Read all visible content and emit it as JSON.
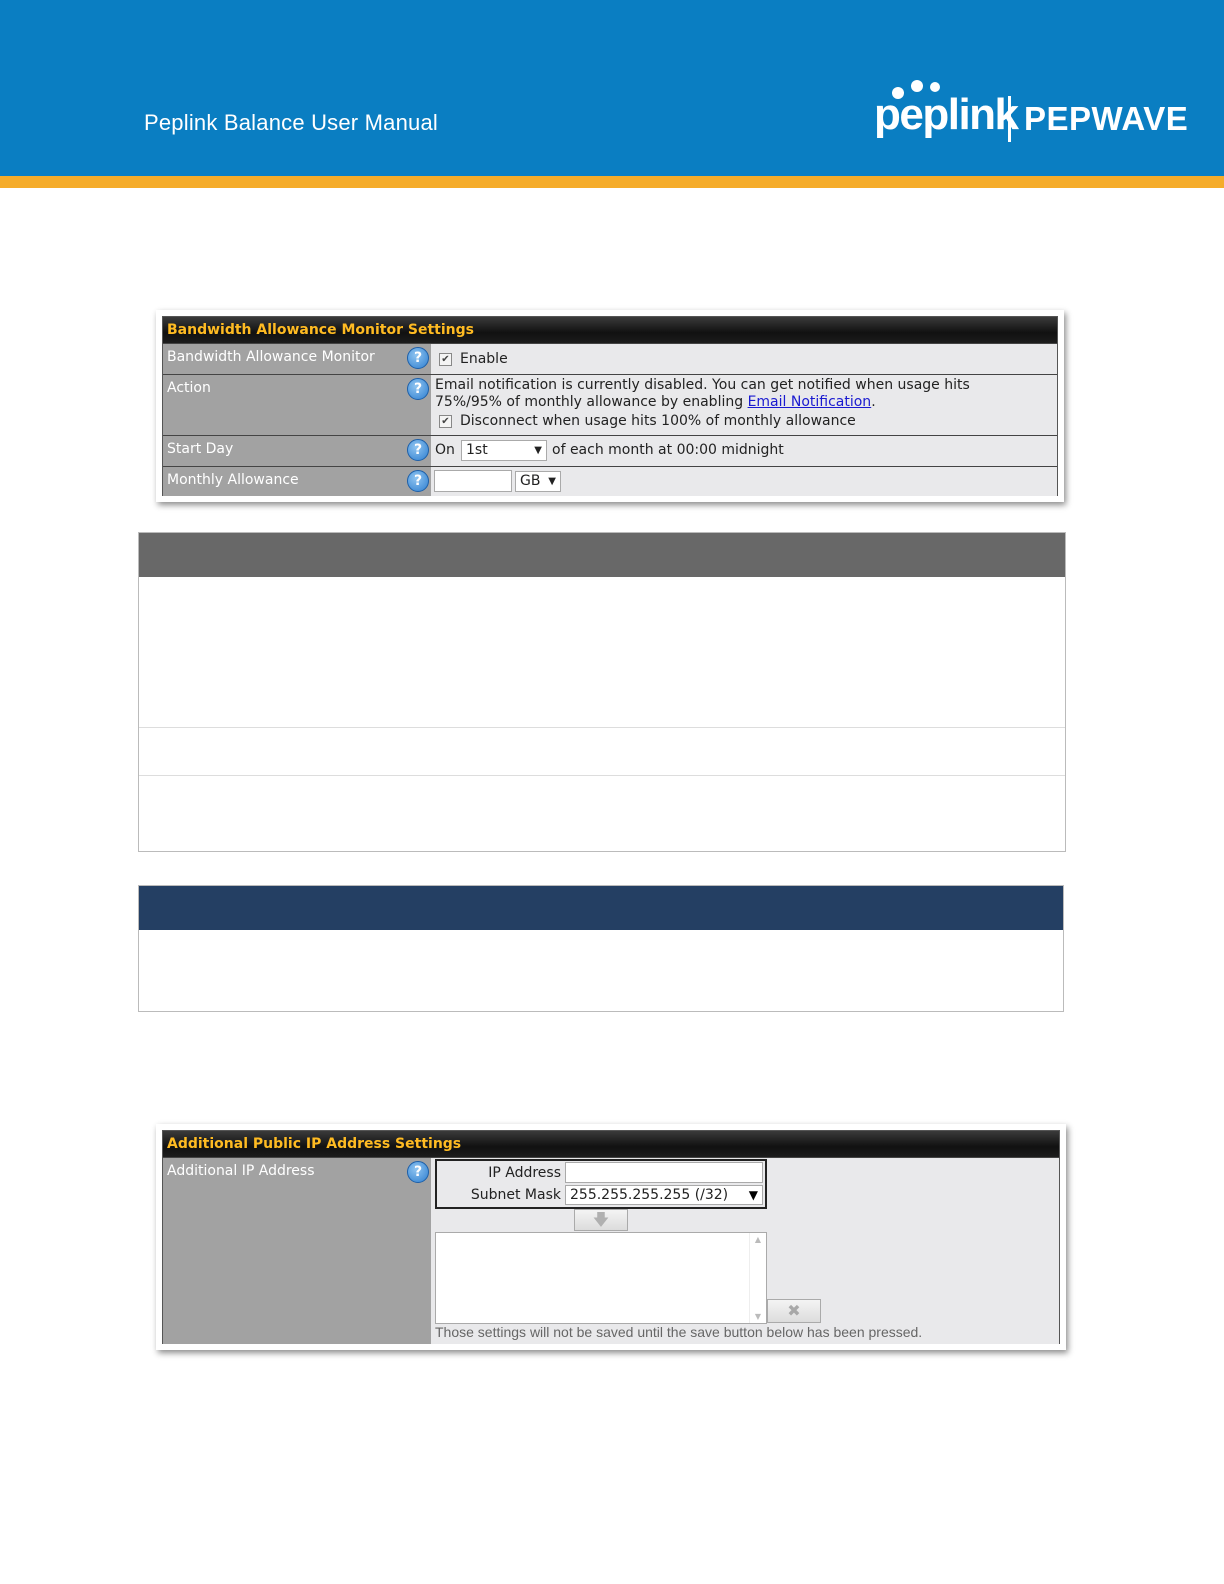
{
  "header": {
    "manual_title": "Peplink Balance User Manual",
    "logo_left": "peplink",
    "logo_right": "PEPWAVE",
    "colors": {
      "band": "#0a7ec2",
      "stripe": "#f5ac2a"
    }
  },
  "bandwidth_panel": {
    "title": "Bandwidth Allowance Monitor Settings",
    "rows": {
      "monitor": {
        "label": "Bandwidth Allowance Monitor",
        "checkbox_label": "Enable",
        "checked": true
      },
      "action": {
        "label": "Action",
        "text_line1": "Email notification is currently disabled. You can get notified when usage hits",
        "text_line2_prefix": "75%/95% of monthly allowance by enabling ",
        "link_text": "Email Notification",
        "text_line2_suffix": ".",
        "disconnect_label": "Disconnect when usage hits 100% of monthly allowance",
        "disconnect_checked": true
      },
      "start_day": {
        "label": "Start Day",
        "prefix": "On",
        "selected": "1st",
        "suffix": "of each month at 00:00 midnight"
      },
      "monthly": {
        "label": "Monthly Allowance",
        "value": "",
        "unit": "GB"
      }
    },
    "help_glyph": "?"
  },
  "blank_box_1": {
    "head_color": "#686868"
  },
  "blank_box_2": {
    "head_color": "#243f63"
  },
  "ip_panel": {
    "title": "Additional Public IP Address Settings",
    "label": "Additional IP Address",
    "ip_label": "IP Address",
    "ip_value": "",
    "mask_label": "Subnet Mask",
    "mask_selected": "255.255.255.255 (/32)",
    "add_icon": "down-arrow-icon",
    "remove_icon": "x-icon",
    "note": "Those settings will not be saved until the save button below has been pressed."
  }
}
